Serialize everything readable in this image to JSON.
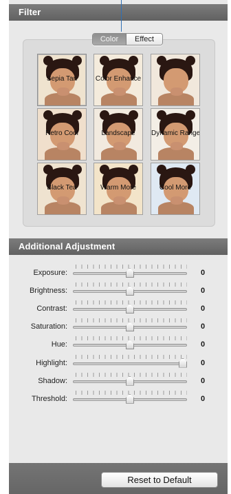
{
  "filter": {
    "title": "Filter",
    "tabs": [
      {
        "label": "Color",
        "selected": true
      },
      {
        "label": "Effect",
        "selected": false
      }
    ],
    "thumbnails": [
      {
        "label": "Sepia Tan",
        "selected": true
      },
      {
        "label": "Color Enhance",
        "selected": false
      },
      {
        "label": "",
        "selected": false
      },
      {
        "label": "Retro Cool",
        "selected": false
      },
      {
        "label": "Landscape",
        "selected": false
      },
      {
        "label": "Dynamic Range",
        "selected": false
      },
      {
        "label": "Black Tea",
        "selected": false
      },
      {
        "label": "Warm More",
        "selected": false
      },
      {
        "label": "Cool More",
        "selected": false
      }
    ]
  },
  "adjustment": {
    "title": "Additional Adjustment",
    "sliders": [
      {
        "label": "Exposure:",
        "value": "0",
        "position": 0.5
      },
      {
        "label": "Brightness:",
        "value": "0",
        "position": 0.5
      },
      {
        "label": "Contrast:",
        "value": "0",
        "position": 0.5
      },
      {
        "label": "Saturation:",
        "value": "0",
        "position": 0.5
      },
      {
        "label": "Hue:",
        "value": "0",
        "position": 0.5
      },
      {
        "label": "Highlight:",
        "value": "0",
        "position": 1.0
      },
      {
        "label": "Shadow:",
        "value": "0",
        "position": 0.5
      },
      {
        "label": "Threshold:",
        "value": "0",
        "position": 0.5
      }
    ]
  },
  "footer": {
    "reset_label": "Reset to Default"
  },
  "colors": {
    "header_bg": "#6e6e6e",
    "panel_bg": "#e9e9e9",
    "pointer_line": "#2f6fb5"
  }
}
